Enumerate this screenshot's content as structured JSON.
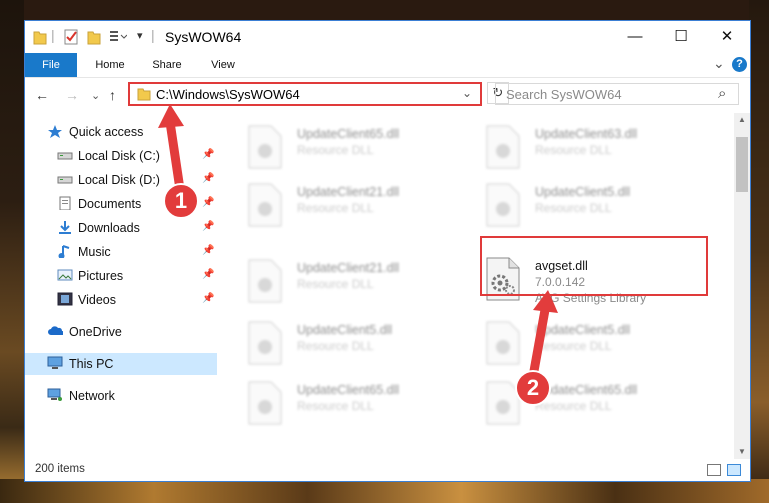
{
  "window": {
    "title": "SysWOW64",
    "controls": {
      "minimize": "—",
      "maximize": "☐",
      "close": "✕"
    }
  },
  "ribbon": {
    "tabs": [
      {
        "label": "File"
      },
      {
        "label": "Home"
      },
      {
        "label": "Share"
      },
      {
        "label": "View"
      }
    ],
    "help": "?",
    "expand": "⌄"
  },
  "nav": {
    "back": "←",
    "forward": "→",
    "recent": "⌄",
    "up": "↑",
    "address": "C:\\Windows\\SysWOW64",
    "dropdown": "⌄",
    "refresh": "↻",
    "search_placeholder": "Search SysWOW64",
    "search_icon": "⌕"
  },
  "sidebar": {
    "items": [
      {
        "label": "Quick access",
        "icon": "star-icon",
        "pinned": false
      },
      {
        "label": "Local Disk (C:)",
        "icon": "drive-icon",
        "pinned": true
      },
      {
        "label": "Local Disk (D:)",
        "icon": "drive-icon",
        "pinned": true
      },
      {
        "label": "Documents",
        "icon": "documents-icon",
        "pinned": true
      },
      {
        "label": "Downloads",
        "icon": "download-icon",
        "pinned": true
      },
      {
        "label": "Music",
        "icon": "music-icon",
        "pinned": true
      },
      {
        "label": "Pictures",
        "icon": "pictures-icon",
        "pinned": true
      },
      {
        "label": "Videos",
        "icon": "videos-icon",
        "pinned": true
      },
      {
        "label": "OneDrive",
        "icon": "cloud-icon",
        "pinned": false
      },
      {
        "label": "This PC",
        "icon": "computer-icon",
        "pinned": false,
        "selected": true
      },
      {
        "label": "Network",
        "icon": "network-icon",
        "pinned": false
      }
    ],
    "pin_glyph": "📌"
  },
  "files": [
    {
      "name": "UpdateClient65.dll",
      "type": "Resource DLL"
    },
    {
      "name": "UpdateClient63.dll",
      "type": "Resource DLL"
    },
    {
      "name": "UpdateClient21.dll",
      "type": "Resource DLL"
    },
    {
      "name": "UpdateClient5.dll",
      "type": "Resource DLL"
    },
    {
      "name": "UpdateClient21.dll",
      "type": "Resource DLL"
    },
    {
      "name": "avgset.dll",
      "type": "7.0.0.142",
      "description": "AVG Settings Library"
    },
    {
      "name": "UpdateClient5.dll",
      "type": "Resource DLL"
    },
    {
      "name": "UpdateClient5.dll",
      "type": "Resource DLL"
    },
    {
      "name": "UpdateClient65.dll",
      "type": "Resource DLL"
    },
    {
      "name": "UpdateClient65.dll",
      "type": "Resource DLL"
    }
  ],
  "status": {
    "item_count": "200 items"
  },
  "annotations": {
    "step1": "1",
    "step2": "2"
  },
  "colors": {
    "accent": "#1979ca",
    "highlight": "#e03a3a",
    "selected": "#cce8ff"
  }
}
